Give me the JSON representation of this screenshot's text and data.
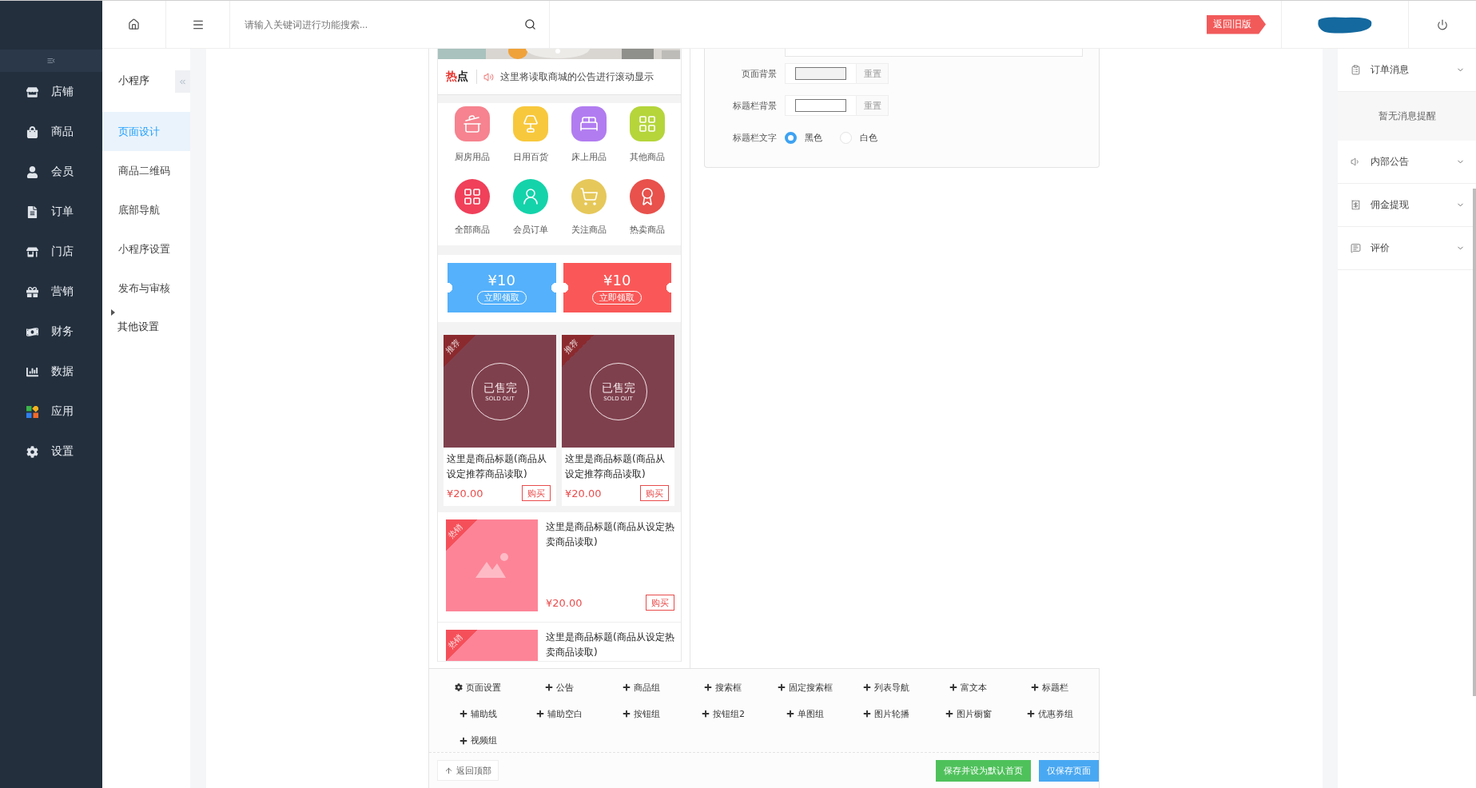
{
  "sidebar": {
    "items": [
      {
        "label": "店铺"
      },
      {
        "label": "商品"
      },
      {
        "label": "会员"
      },
      {
        "label": "订单"
      },
      {
        "label": "门店"
      },
      {
        "label": "营销"
      },
      {
        "label": "财务"
      },
      {
        "label": "数据"
      },
      {
        "label": "应用"
      },
      {
        "label": "设置"
      }
    ]
  },
  "top_bar": {
    "search": {
      "placeholder": "请输入关键词进行功能搜索..."
    },
    "old_version_button": "返回旧版"
  },
  "sub_sidebar": {
    "title": "小程序",
    "items": [
      {
        "label": "页面设计",
        "selected": true,
        "kind": "link"
      },
      {
        "label": "商品二维码",
        "selected": false,
        "kind": "link"
      },
      {
        "label": "底部导航",
        "selected": false,
        "kind": "link"
      },
      {
        "label": "小程序设置",
        "selected": false,
        "kind": "link"
      },
      {
        "label": "发布与审核",
        "selected": false,
        "kind": "link"
      },
      {
        "label": "其他设置",
        "selected": false,
        "kind": "group"
      }
    ]
  },
  "preview": {
    "notice": {
      "badge": "热点",
      "text": "这里将读取商城的公告进行滚动显示"
    },
    "nav_icons": [
      {
        "label": "厨房用品",
        "color": "#f6838f",
        "kind": "rounded"
      },
      {
        "label": "日用百货",
        "color": "#f8c83c",
        "kind": "rounded"
      },
      {
        "label": "床上用品",
        "color": "#b17cf0",
        "kind": "rounded"
      },
      {
        "label": "其他商品",
        "color": "#b5d53b",
        "kind": "rounded"
      },
      {
        "label": "全部商品",
        "color": "#f0405a",
        "kind": "round"
      },
      {
        "label": "会员订单",
        "color": "#14d3aa",
        "kind": "round"
      },
      {
        "label": "关注商品",
        "color": "#e6c85a",
        "kind": "round"
      },
      {
        "label": "热卖商品",
        "color": "#e8514c",
        "kind": "round"
      }
    ],
    "coupons": [
      {
        "amount": "¥10",
        "action": "立即领取",
        "color": "#55b1fb"
      },
      {
        "amount": "¥10",
        "action": "立即领取",
        "color": "#fa5858"
      }
    ],
    "recommended": [
      {
        "badge": "推荐",
        "stamp": "已售完",
        "stamp_en": "SOLD OUT",
        "title": "这里是商品标题(商品从设定推荐商品读取)",
        "price": "¥20.00",
        "buy": "购买"
      },
      {
        "badge": "推荐",
        "stamp": "已售完",
        "stamp_en": "SOLD OUT",
        "title": "这里是商品标题(商品从设定推荐商品读取)",
        "price": "¥20.00",
        "buy": "购买"
      }
    ],
    "hot_items": [
      {
        "badge": "热销",
        "title": "这里是商品标题(商品从设定热卖商品读取)",
        "price": "¥20.00",
        "buy": "购买"
      },
      {
        "badge": "热销",
        "title": "这里是商品标题(商品从设定热卖商品读取)"
      }
    ]
  },
  "settings": {
    "rows": [
      {
        "kind": "color",
        "label": "页面背景",
        "color": "#f2f2f2",
        "reset": "重置"
      },
      {
        "kind": "color",
        "label": "标题栏背景",
        "color": "#ffffff",
        "reset": "重置"
      },
      {
        "kind": "radio",
        "label": "标题栏文字",
        "options": [
          {
            "label": "黑色",
            "selected": true
          },
          {
            "label": "白色",
            "selected": false
          }
        ]
      }
    ]
  },
  "toolbar": {
    "items": [
      {
        "label": "页面设置",
        "kind": "settings"
      },
      {
        "label": "公告",
        "kind": "add"
      },
      {
        "label": "商品组",
        "kind": "add"
      },
      {
        "label": "搜索框",
        "kind": "add"
      },
      {
        "label": "固定搜索框",
        "kind": "add"
      },
      {
        "label": "列表导航",
        "kind": "add"
      },
      {
        "label": "富文本",
        "kind": "add"
      },
      {
        "label": "标题栏",
        "kind": "add"
      },
      {
        "label": "辅助线",
        "kind": "add"
      },
      {
        "label": "辅助空白",
        "kind": "add"
      },
      {
        "label": "按钮组",
        "kind": "add"
      },
      {
        "label": "按钮组2",
        "kind": "add"
      },
      {
        "label": "单图组",
        "kind": "add"
      },
      {
        "label": "图片轮播",
        "kind": "add"
      },
      {
        "label": "图片橱窗",
        "kind": "add"
      },
      {
        "label": "优惠券组",
        "kind": "add"
      },
      {
        "label": "视频组",
        "kind": "add"
      }
    ],
    "back_to_top": "返回顶部",
    "buttons": [
      {
        "label": "保存并设为默认首页",
        "kind": "success"
      },
      {
        "label": "仅保存页面",
        "kind": "primary"
      }
    ]
  },
  "right_panel": {
    "sections": [
      {
        "label": "订单消息",
        "empty_text": "暂无消息提醒"
      },
      {
        "label": "内部公告"
      },
      {
        "label": "佣金提现"
      },
      {
        "label": "评价"
      }
    ]
  }
}
